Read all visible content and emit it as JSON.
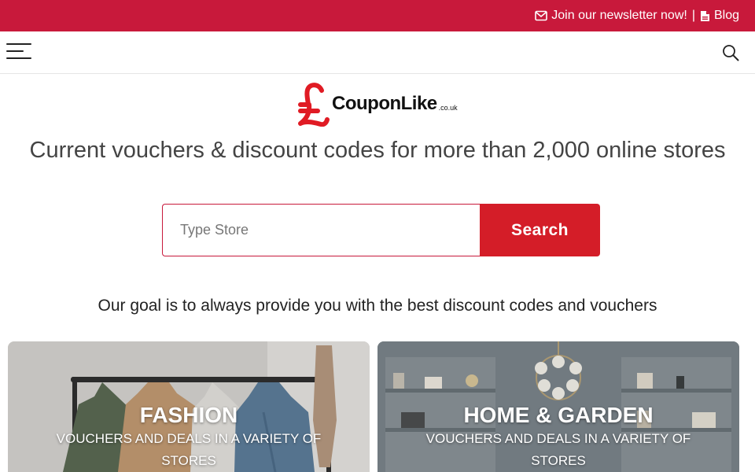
{
  "topbar": {
    "newsletter_label": "Join our newsletter now!",
    "separator": "|",
    "blog_label": "Blog",
    "background": "#c8193b",
    "newsletter_icon": "envelope-icon",
    "blog_icon": "file-icon"
  },
  "navbar": {
    "menu_icon": "hamburger-menu-icon",
    "search_icon": "search-icon"
  },
  "logo": {
    "brand": "CouponLike",
    "tld": ".co.uk",
    "mark_icon": "pound-sign-icon",
    "mark_color": "#e01b24"
  },
  "headline": "Current vouchers & discount codes for more than 2,000 online stores",
  "search": {
    "placeholder": "Type Store",
    "value": "",
    "button_label": "Search",
    "button_color": "#d41d28"
  },
  "goal": "Our goal is to always provide you with the best discount codes and vouchers",
  "categories": [
    {
      "title": "FASHION",
      "subtitle": "VOUCHERS AND DEALS IN A VARIETY OF STORES"
    },
    {
      "title": "HOME & GARDEN",
      "subtitle": "VOUCHERS AND DEALS IN A VARIETY OF STORES"
    }
  ]
}
